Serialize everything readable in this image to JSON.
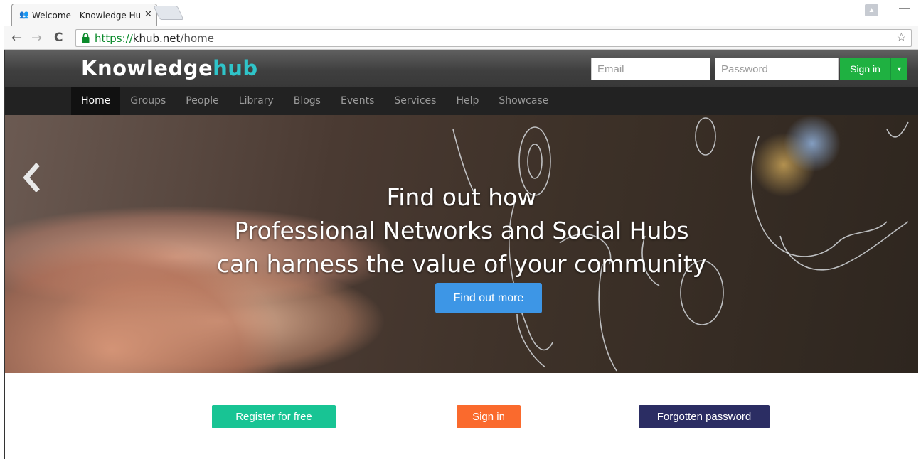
{
  "browser": {
    "tab_title": "Welcome - Knowledge Hu",
    "tab_close": "✕",
    "url_scheme": "https://",
    "url_host": "khub.net",
    "url_path": "/home",
    "back_glyph": "←",
    "forward_glyph": "→",
    "reload_glyph": "C",
    "star_glyph": "☆",
    "minimize_glyph": "—"
  },
  "header": {
    "logo_main": "Knowledge",
    "logo_accent": "hub",
    "email_placeholder": "Email",
    "password_placeholder": "Password",
    "signin_label": "Sign in",
    "signin_caret": "▼"
  },
  "nav": {
    "items": [
      {
        "label": "Home",
        "active": true
      },
      {
        "label": "Groups"
      },
      {
        "label": "People"
      },
      {
        "label": "Library"
      },
      {
        "label": "Blogs"
      },
      {
        "label": "Events"
      },
      {
        "label": "Services"
      },
      {
        "label": "Help"
      },
      {
        "label": "Showcase"
      }
    ]
  },
  "hero": {
    "line1": "Find out how",
    "line2": "Professional Networks and Social Hubs",
    "line3": "can harness the value of your community",
    "cta_label": "Find out more"
  },
  "actions": {
    "register_label": "Register for free",
    "signin_label": "Sign in",
    "forgot_label": "Forgotten password"
  },
  "colors": {
    "signin_green": "#1fb141",
    "hub_accent": "#2fc4c9",
    "cta_blue": "#3d96e6",
    "register_teal": "#18c494",
    "signin_orange": "#fa6a2d",
    "forgot_navy": "#2b2d63"
  }
}
